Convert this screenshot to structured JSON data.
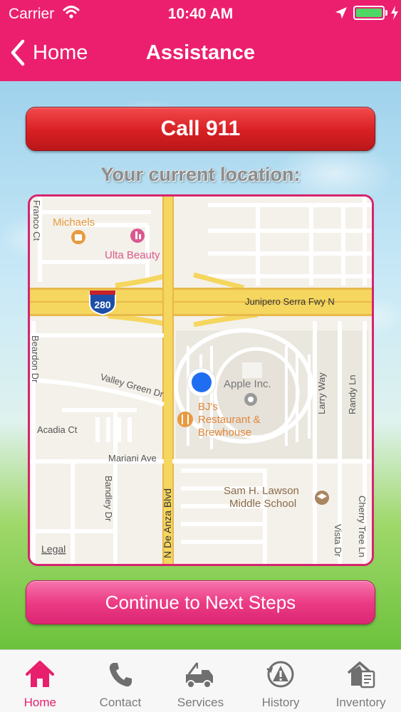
{
  "status_bar": {
    "carrier": "Carrier",
    "time": "10:40 AM",
    "battery_level": 1.0,
    "icons": [
      "wifi-icon",
      "location-arrow-icon",
      "battery-icon",
      "charging-bolt-icon"
    ]
  },
  "nav": {
    "back_label": "Home",
    "title": "Assistance"
  },
  "actions": {
    "call_label": "Call 911",
    "continue_label": "Continue to Next Steps"
  },
  "location": {
    "heading": "Your current location:"
  },
  "map": {
    "labels": {
      "michaels": "Michaels",
      "ulta": "Ulta Beauty",
      "franco": "Franco Ct",
      "hwy_shield": "280",
      "junipero": "Junipero Serra Fwy N",
      "beardon": "Beardon Dr",
      "valley_green": "Valley Green Dr",
      "apple": "Apple Inc.",
      "bjs_1": "BJ's",
      "bjs_2": "Restaurant &",
      "bjs_3": "Brewhouse",
      "acadia": "Acadia Ct",
      "mariani": "Mariani Ave",
      "bandley": "Bandley Dr",
      "de_anza": "N De Anza Blvd",
      "sam_lawson_1": "Sam H. Lawson",
      "sam_lawson_2": "Middle School",
      "larry": "Larry Way",
      "randy": "Randy Ln",
      "vista": "Vista Dr",
      "cherry_tree": "Cherry Tree Ln",
      "legal": "Legal"
    },
    "colors": {
      "land": "#f4f1ea",
      "street": "#ffffff",
      "freeway": "#f5d65e",
      "freeway_edge": "#e9b84a",
      "poi_orange": "#e79a3f",
      "poi_pink": "#d9598e",
      "user_dot": "#1f6ef2"
    }
  },
  "tabs": [
    {
      "label": "Home",
      "icon": "house-icon",
      "active": true
    },
    {
      "label": "Contact",
      "icon": "phone-icon",
      "active": false
    },
    {
      "label": "Services",
      "icon": "tow-truck-icon",
      "active": false
    },
    {
      "label": "History",
      "icon": "warning-clock-icon",
      "active": false
    },
    {
      "label": "Inventory",
      "icon": "house-clipboard-icon",
      "active": false
    }
  ],
  "theme": {
    "primary": "#ec1f6f",
    "call_red": "#d81f23",
    "tab_active": "#e81f6d",
    "tab_inactive": "#7a7a7a"
  }
}
